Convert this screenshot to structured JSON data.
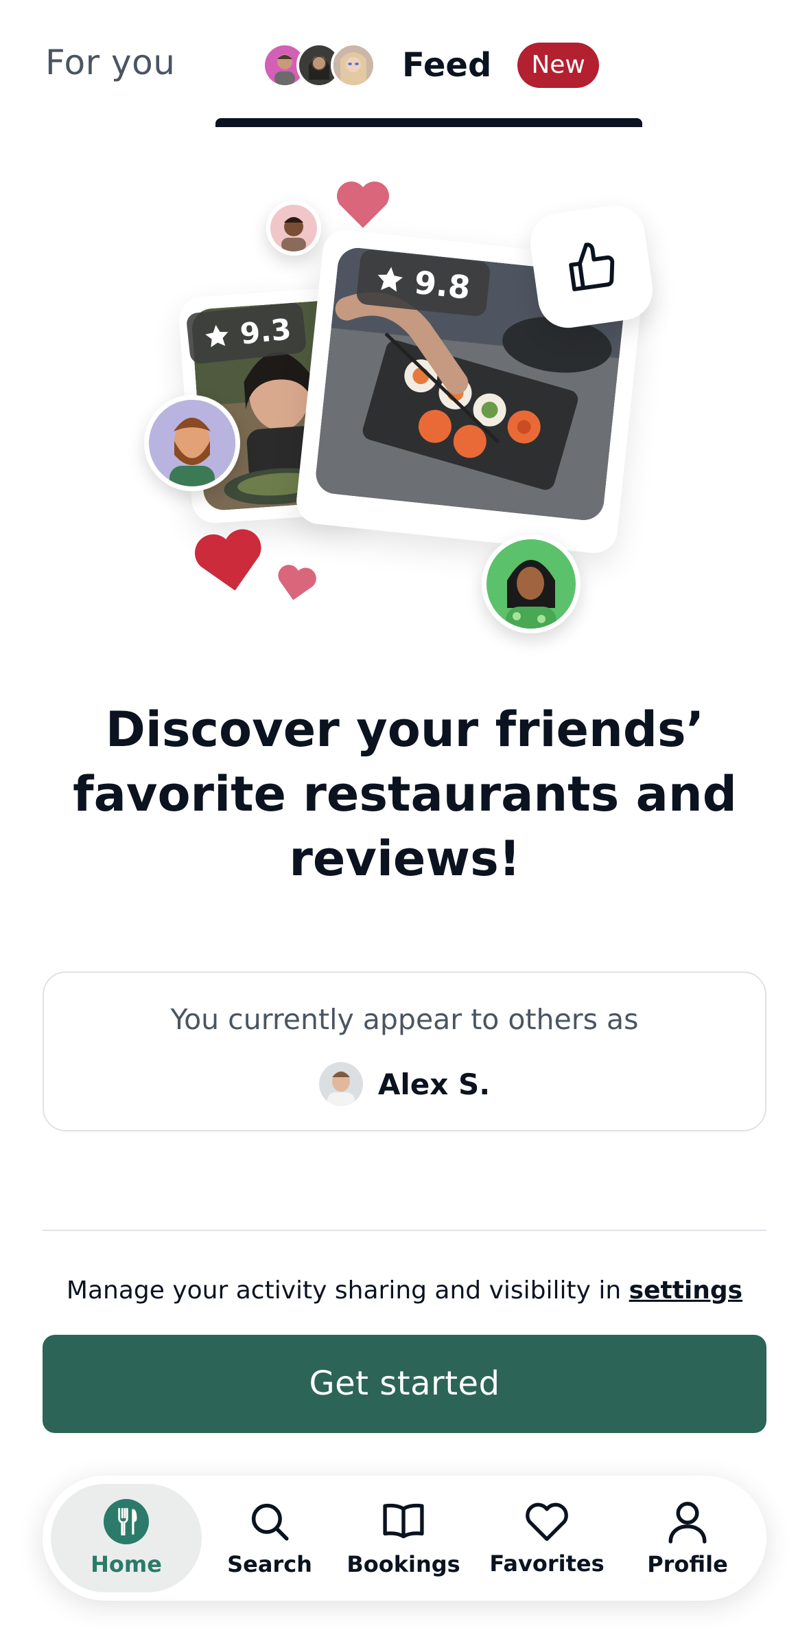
{
  "tabs": {
    "for_you": "For you",
    "feed": "Feed",
    "new_badge": "New"
  },
  "illustration": {
    "rating_left": "9.3",
    "rating_right": "9.8"
  },
  "headline": "Discover your friends’ favorite restaurants and reviews!",
  "appear_card": {
    "text": "You currently appear to others as",
    "user_name": "Alex S."
  },
  "manage": {
    "text": "Manage your activity sharing and visibility in ",
    "link": "settings"
  },
  "cta": "Get started",
  "bottom_nav": [
    {
      "label": "Home",
      "icon": "fork-knife-icon",
      "active": true
    },
    {
      "label": "Search",
      "icon": "search-icon",
      "active": false
    },
    {
      "label": "Bookings",
      "icon": "book-icon",
      "active": false
    },
    {
      "label": "Favorites",
      "icon": "heart-icon",
      "active": false
    },
    {
      "label": "Profile",
      "icon": "user-icon",
      "active": false
    }
  ],
  "colors": {
    "primary": "#2c6458",
    "active_nav": "#2c7a69",
    "badge": "#b3202f",
    "heart": "#cc2b3b",
    "heart_light": "#d9667a",
    "text": "#0b1320",
    "muted": "#4a5563"
  }
}
